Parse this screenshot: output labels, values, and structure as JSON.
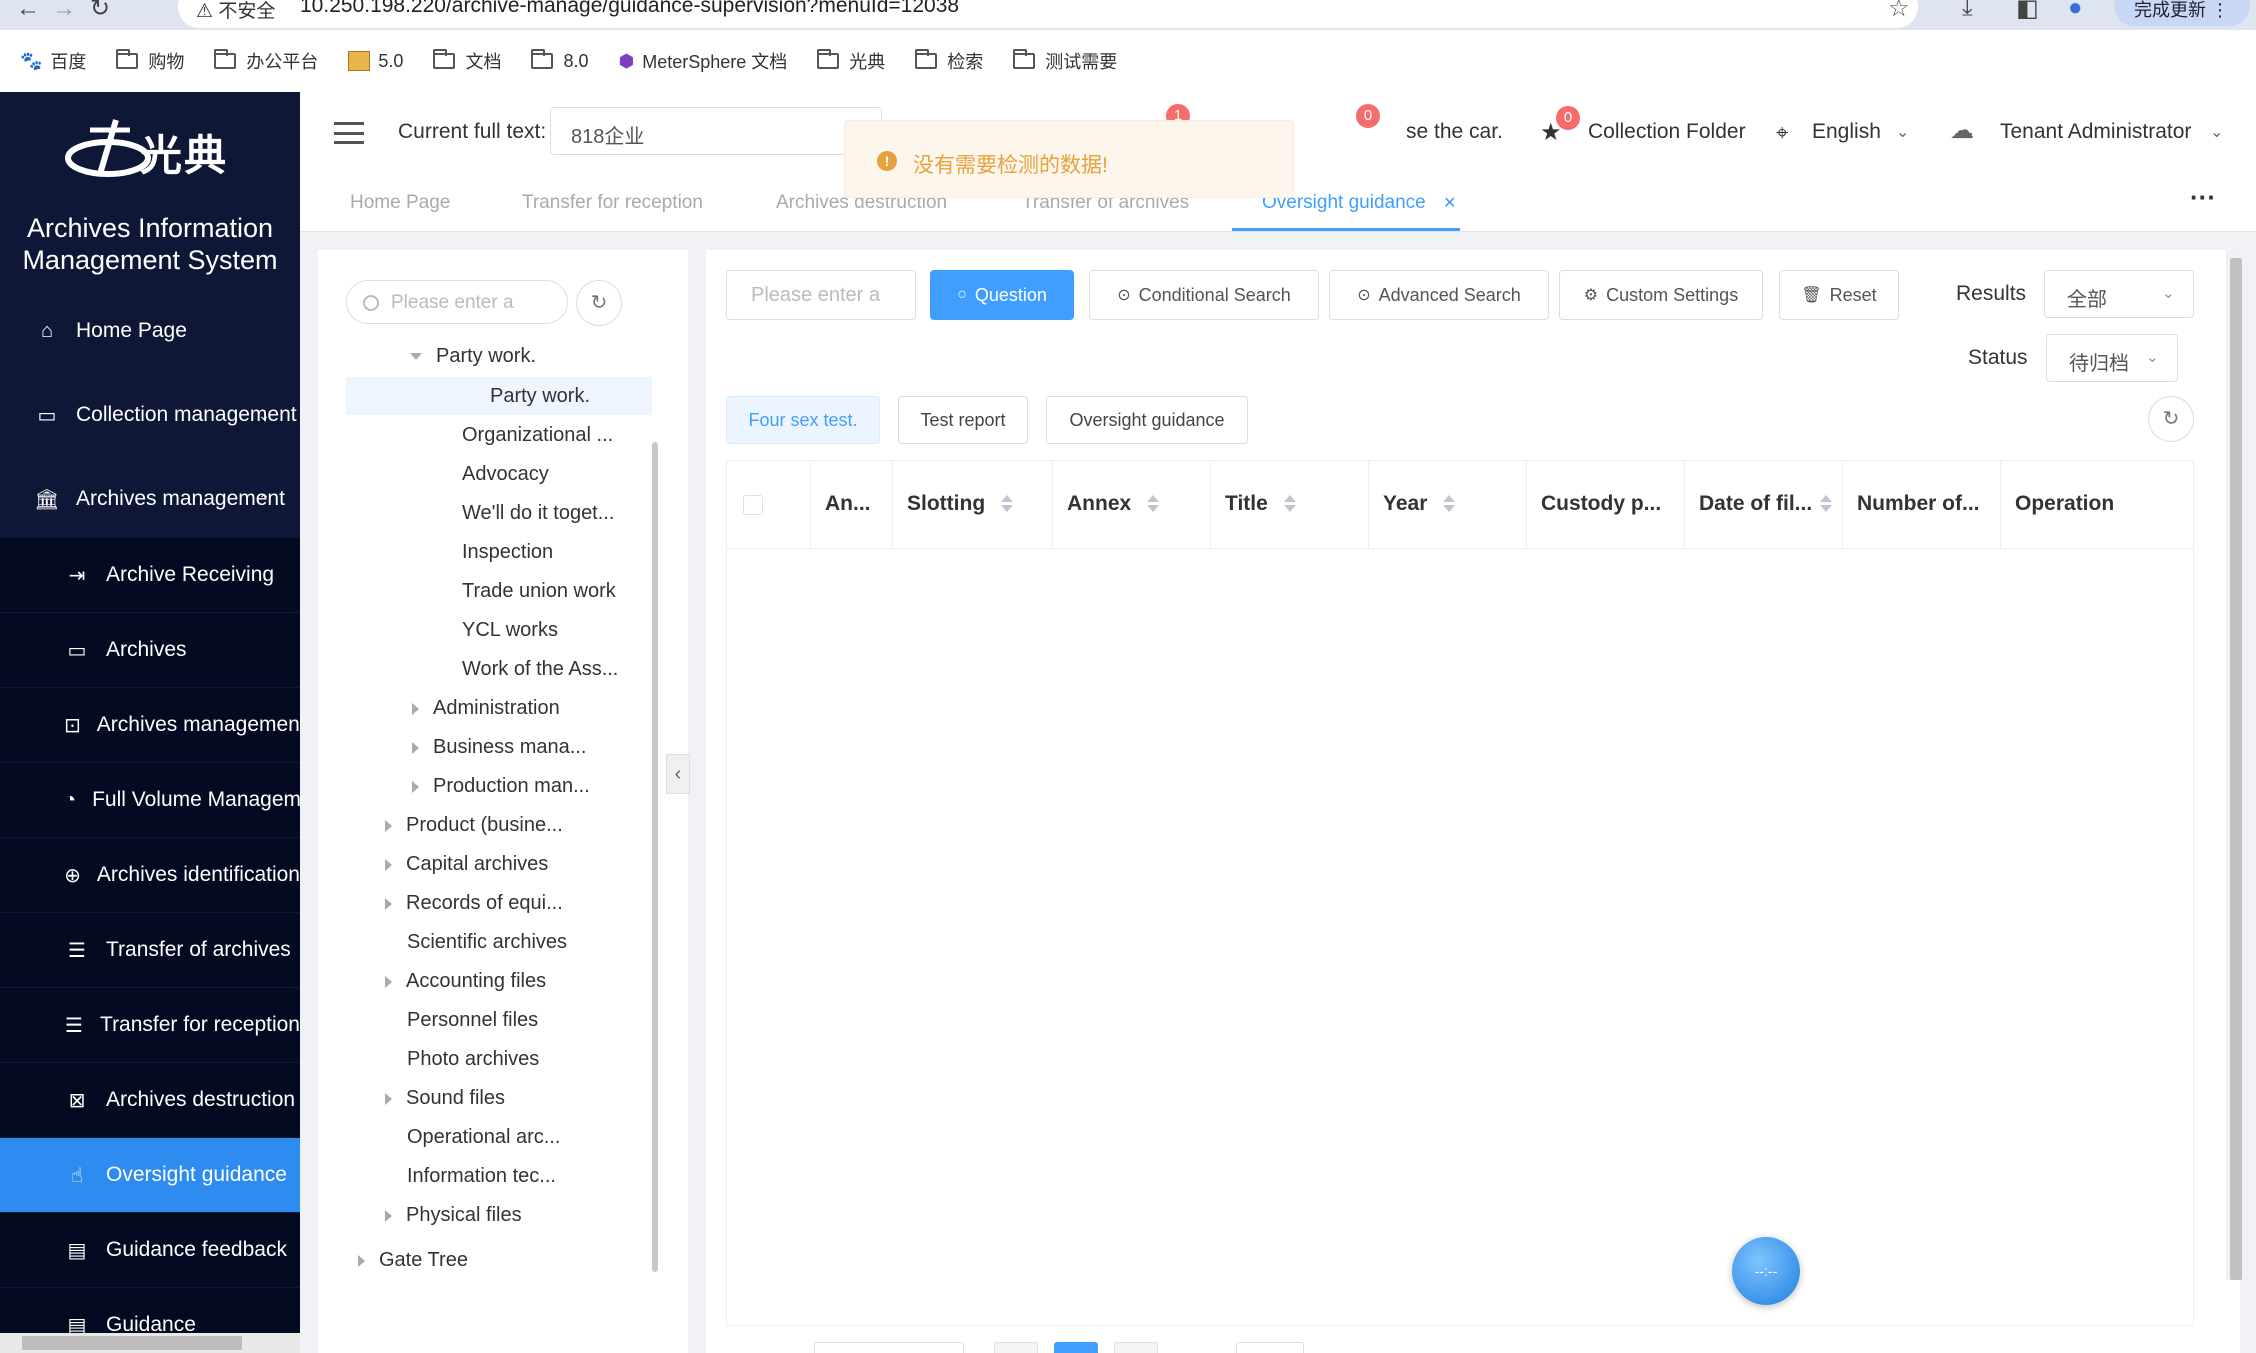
{
  "browser": {
    "security_warning": "不安全",
    "url": "10.250.198.220/archive-manage/guidance-supervision?menuId=12038",
    "update_label": "完成更新",
    "bookmarks": [
      "百度",
      "购物",
      "办公平台",
      "5.0",
      "文档",
      "8.0",
      "MeterSphere 文档",
      "光典",
      "检索",
      "测试需要"
    ]
  },
  "app": {
    "logo_text": "光典",
    "system_name_line1": "Archives Information",
    "system_name_line2": "Management System"
  },
  "sidebar": {
    "items": [
      {
        "label": "Home Page",
        "icon": "home-icon"
      },
      {
        "label": "Collection management",
        "icon": "collection-icon"
      },
      {
        "label": "Archives management",
        "icon": "bank-icon"
      },
      {
        "label": "Archive Receiving",
        "icon": "receive-icon"
      },
      {
        "label": "Archives",
        "icon": "folder-icon"
      },
      {
        "label": "Archives management",
        "icon": "briefcase-icon"
      },
      {
        "label": "Full Volume Management",
        "icon": "volume-icon"
      },
      {
        "label": "Archives identification",
        "icon": "identify-icon"
      },
      {
        "label": "Transfer of archives",
        "icon": "list-icon"
      },
      {
        "label": "Transfer for reception",
        "icon": "list-icon"
      },
      {
        "label": "Archives destruction",
        "icon": "destroy-icon"
      },
      {
        "label": "Oversight guidance",
        "icon": "hand-icon"
      },
      {
        "label": "Guidance feedback",
        "icon": "message-icon"
      },
      {
        "label": "Guidance",
        "icon": "message-icon"
      }
    ]
  },
  "header": {
    "current_label": "Current full text:",
    "current_value": "818企业",
    "badge1": "1",
    "badge2": "0",
    "badge3": "0",
    "car_text": "se the car.",
    "collection_folder": "Collection Folder",
    "language": "English",
    "user": "Tenant Administrator"
  },
  "toast": {
    "message": "没有需要检测的数据!"
  },
  "tabs": [
    {
      "label": "Home Page"
    },
    {
      "label": "Transfer for reception"
    },
    {
      "label": "Archives destruction"
    },
    {
      "label": "Transfer of archives"
    },
    {
      "label": "Oversight guidance"
    }
  ],
  "tree": {
    "search_placeholder": "Please enter a",
    "nodes": [
      {
        "label": "Party work."
      },
      {
        "label": "Party work."
      },
      {
        "label": "Organizational ..."
      },
      {
        "label": "Advocacy"
      },
      {
        "label": "We'll do it toget..."
      },
      {
        "label": "Inspection"
      },
      {
        "label": "Trade union work"
      },
      {
        "label": "YCL works"
      },
      {
        "label": "Work of the Ass..."
      },
      {
        "label": "Administration"
      },
      {
        "label": "Business mana..."
      },
      {
        "label": "Production man..."
      },
      {
        "label": "Product (busine..."
      },
      {
        "label": "Capital archives"
      },
      {
        "label": "Records of equi..."
      },
      {
        "label": "Scientific archives"
      },
      {
        "label": "Accounting files"
      },
      {
        "label": "Personnel files"
      },
      {
        "label": "Photo archives"
      },
      {
        "label": "Sound files"
      },
      {
        "label": "Operational arc..."
      },
      {
        "label": "Information tec..."
      },
      {
        "label": "Physical files"
      },
      {
        "label": "Gate Tree"
      }
    ]
  },
  "toolbar": {
    "query_placeholder": "Please enter a",
    "question": "Question",
    "conditional_search": "Conditional Search",
    "advanced_search": "Advanced Search",
    "custom_settings": "Custom Settings",
    "reset": "Reset",
    "results_label": "Results",
    "results_value": "全部",
    "status_label": "Status",
    "status_value": "待归档"
  },
  "subtabs": [
    {
      "label": "Four sex test."
    },
    {
      "label": "Test report"
    },
    {
      "label": "Oversight guidance"
    }
  ],
  "table": {
    "columns": [
      "An...",
      "Slotting",
      "Annex",
      "Title",
      "Year",
      "Custody p...",
      "Date of fil...",
      "Number of...",
      "Operation"
    ]
  },
  "float_button": {
    "label": "--:--"
  }
}
